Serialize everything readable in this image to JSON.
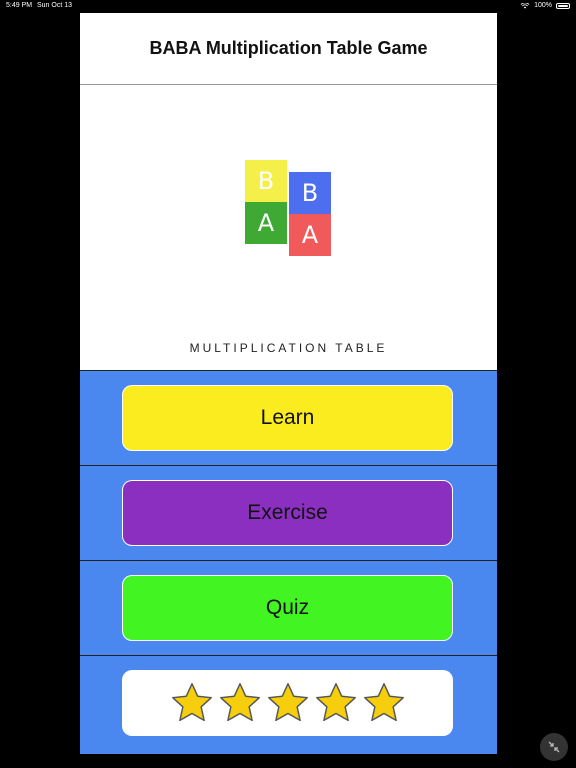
{
  "status_bar": {
    "time": "5:49 PM",
    "date": "Sun Oct 13",
    "battery": "100%"
  },
  "header": {
    "title": "BABA Multiplication Table Game"
  },
  "logo": {
    "blocks": [
      {
        "letter": "B",
        "color": "#f5ef4a"
      },
      {
        "letter": "A",
        "color": "#3faa33"
      },
      {
        "letter": "B",
        "color": "#4e6ef0"
      },
      {
        "letter": "A",
        "color": "#f05a5a"
      }
    ],
    "subtitle": "MULTIPLICATION TABLE"
  },
  "menu": {
    "background": "#4a87ee",
    "buttons": [
      {
        "label": "Learn",
        "color": "#fbec1f"
      },
      {
        "label": "Exercise",
        "color": "#8b2fc0"
      },
      {
        "label": "Quiz",
        "color": "#42f422"
      }
    ],
    "rating": {
      "stars": 5,
      "max": 5,
      "star_color": "#f5cf0c"
    }
  },
  "icons": {
    "collapse": "collapse-arrows-icon"
  }
}
